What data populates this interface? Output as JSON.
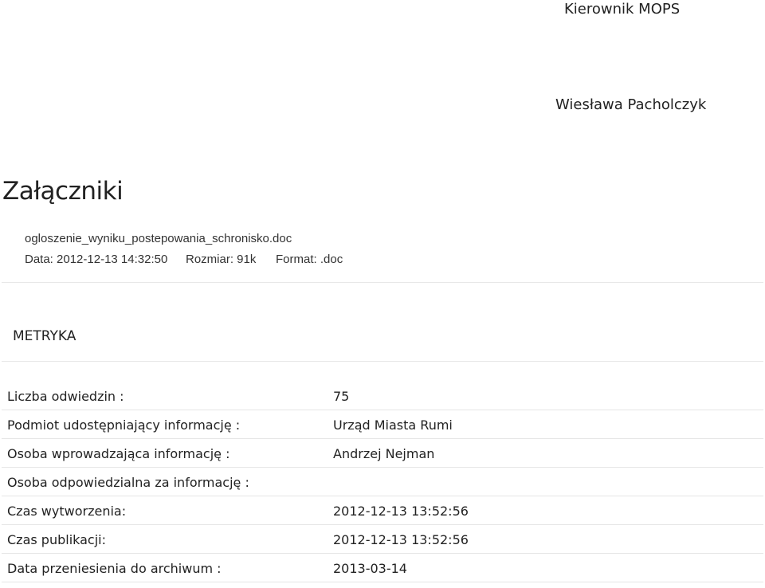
{
  "signature": {
    "role": "Kierownik MOPS",
    "name": "Wiesława Pacholczyk"
  },
  "attachments": {
    "heading": "Załączniki",
    "items": [
      {
        "filename": "ogloszenie_wyniku_postepowania_schronisko.doc",
        "date": "Data: 2012-12-13 14:32:50",
        "size": "Rozmiar: 91k",
        "format": "Format: .doc"
      }
    ]
  },
  "metryka": {
    "heading": "METRYKA",
    "rows": [
      {
        "label": "Liczba odwiedzin :",
        "value": "75"
      },
      {
        "label": "Podmiot udostępniający informację :",
        "value": "Urząd Miasta Rumi"
      },
      {
        "label": "Osoba wprowadzająca informację :",
        "value": "Andrzej Nejman"
      },
      {
        "label": "Osoba odpowiedzialna za informację :",
        "value": ""
      },
      {
        "label": "Czas wytworzenia:",
        "value": "2012-12-13 13:52:56"
      },
      {
        "label": "Czas publikacji:",
        "value": "2012-12-13 13:52:56"
      },
      {
        "label": "Data przeniesienia do archiwum :",
        "value": "2013-03-14"
      }
    ]
  }
}
